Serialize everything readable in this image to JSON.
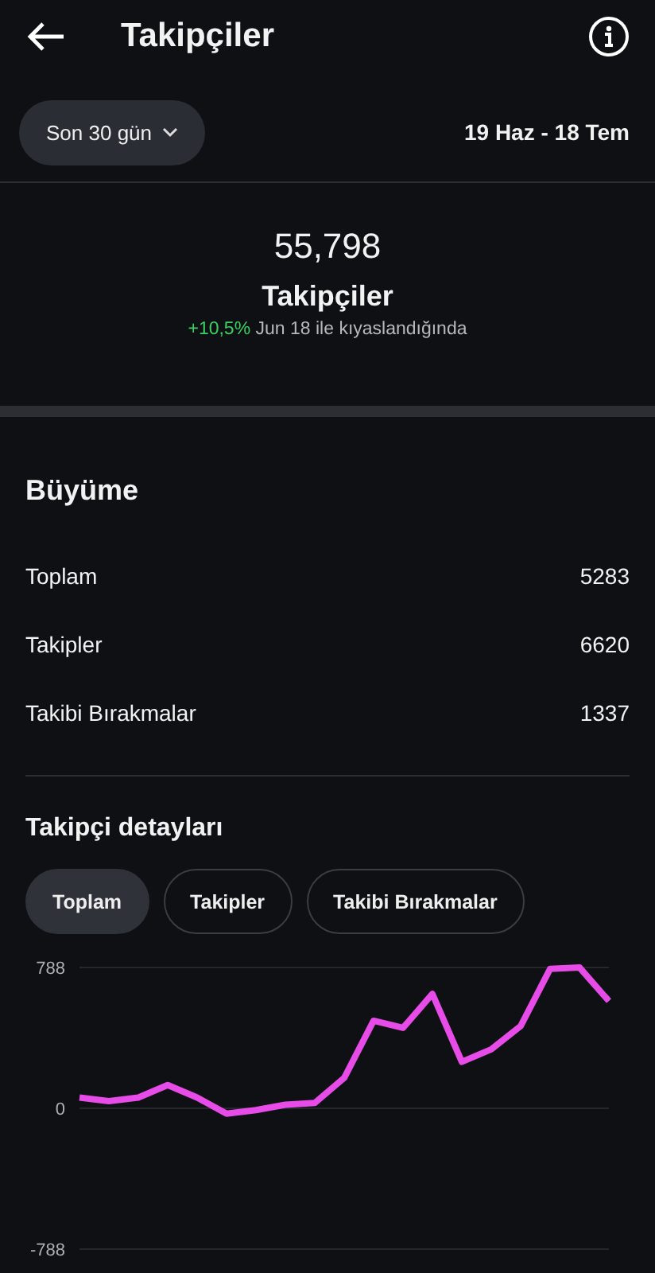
{
  "header": {
    "title": "Takipçiler"
  },
  "filter": {
    "period": "Son 30 gün",
    "date_range": "19 Haz - 18 Tem"
  },
  "summary": {
    "value": "55,798",
    "label": "Takipçiler",
    "change": "+10,5%",
    "comparison": "Jun 18 ile kıyaslandığında"
  },
  "growth": {
    "title": "Büyüme",
    "rows": [
      {
        "label": "Toplam",
        "value": "5283"
      },
      {
        "label": "Takipler",
        "value": "6620"
      },
      {
        "label": "Takibi Bırakmalar",
        "value": "1337"
      }
    ]
  },
  "details": {
    "title": "Takipçi detayları",
    "chips": [
      {
        "label": "Toplam",
        "selected": true
      },
      {
        "label": "Takipler",
        "selected": false
      },
      {
        "label": "Takibi Bırakmalar",
        "selected": false
      }
    ],
    "chart_data": {
      "type": "line",
      "values": [
        60,
        40,
        60,
        130,
        60,
        -30,
        -10,
        20,
        30,
        170,
        490,
        450,
        640,
        260,
        330,
        460,
        780,
        788,
        600
      ],
      "ylim": [
        -788,
        788
      ],
      "yticks": [
        -788,
        0,
        788
      ]
    }
  }
}
